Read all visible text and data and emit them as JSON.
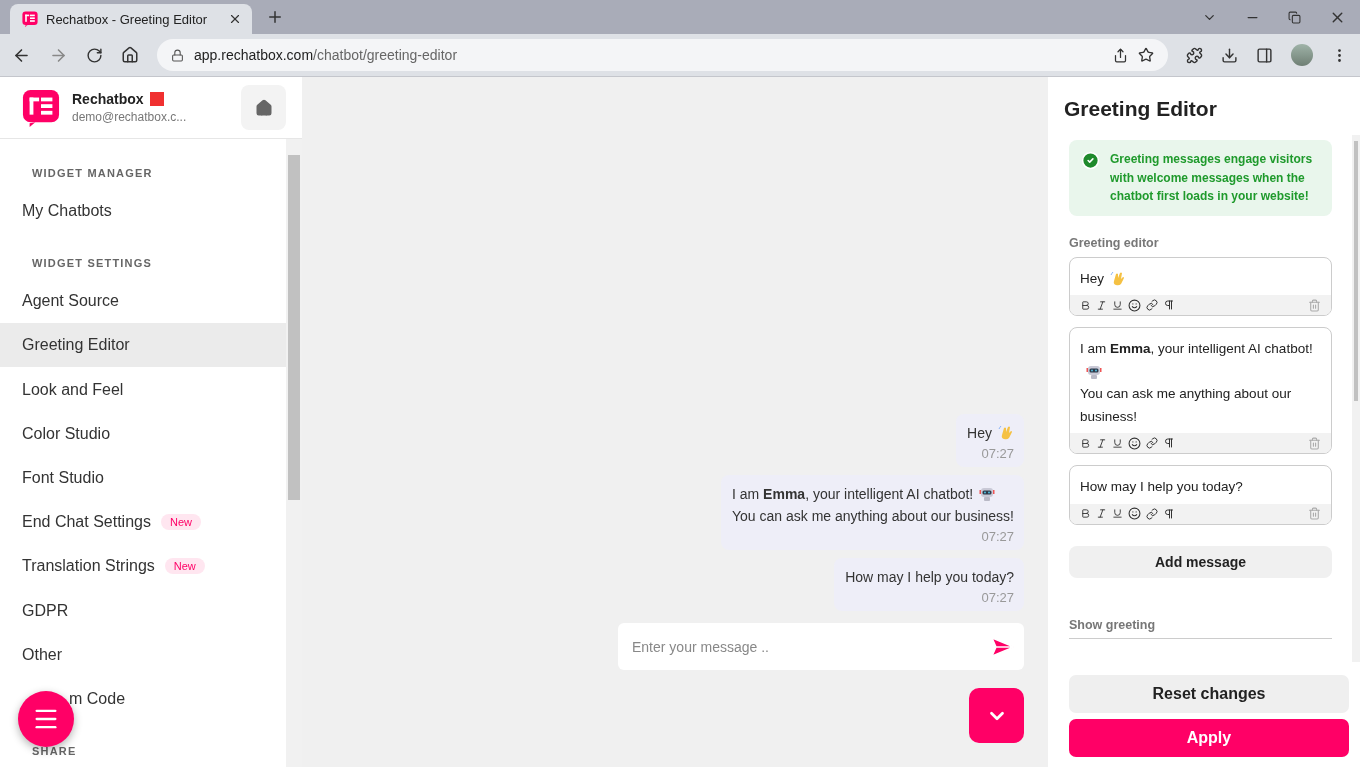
{
  "browser": {
    "tab_title": "Rechatbox - Greeting Editor",
    "url_host": "app.rechatbox.com",
    "url_path": "/chatbot/greeting-editor"
  },
  "sidebar": {
    "brand": "Rechatbox",
    "email": "demo@rechatbox.c...",
    "sections": [
      {
        "heading": "WIDGET MANAGER",
        "items": [
          {
            "label": "My Chatbots",
            "selected": false
          }
        ]
      },
      {
        "heading": "WIDGET SETTINGS",
        "items": [
          {
            "label": "Agent Source",
            "selected": false
          },
          {
            "label": "Greeting Editor",
            "selected": true
          },
          {
            "label": "Look and Feel",
            "selected": false
          },
          {
            "label": "Color Studio",
            "selected": false
          },
          {
            "label": "Font Studio",
            "selected": false
          },
          {
            "label": "End Chat Settings",
            "selected": false,
            "badge": "New"
          },
          {
            "label": "Translation Strings",
            "selected": false,
            "badge": "New"
          },
          {
            "label": "GDPR",
            "selected": false
          },
          {
            "label": "Other",
            "selected": false
          },
          {
            "label": "m Code",
            "selected": false
          }
        ]
      },
      {
        "heading": "SHARE"
      }
    ]
  },
  "chat": {
    "messages": [
      {
        "lines": [
          {
            "text": "Hey"
          }
        ],
        "time": "07:27"
      },
      {
        "lines": [
          {
            "text": "I am **Emma**, your intelligent AI chatbot!"
          },
          {
            "text": "You can ask me anything about our business!"
          }
        ],
        "time": "07:27"
      },
      {
        "lines": [
          {
            "text": "How may I help you today?"
          }
        ],
        "time": "07:27"
      }
    ],
    "input": {
      "placeholder": "Enter your message .."
    }
  },
  "editor": {
    "title": "Greeting Editor",
    "notice": "Greeting messages engage visitors with welcome messages when the chatbot first loads in your website!",
    "label": "Greeting editor",
    "messages": [
      {
        "lines": [
          {
            "text": "Hey"
          }
        ]
      },
      {
        "lines": [
          {
            "text": "I am **Emma**, your intelligent AI chatbot!"
          },
          {
            "text": "You can ask me anything about our business!"
          }
        ]
      },
      {
        "lines": [
          {
            "text": "How may I help you today?"
          }
        ]
      }
    ],
    "add_button": "Add message",
    "show_greeting_label": "Show greeting",
    "reset_button": "Reset changes",
    "apply_button": "Apply"
  }
}
